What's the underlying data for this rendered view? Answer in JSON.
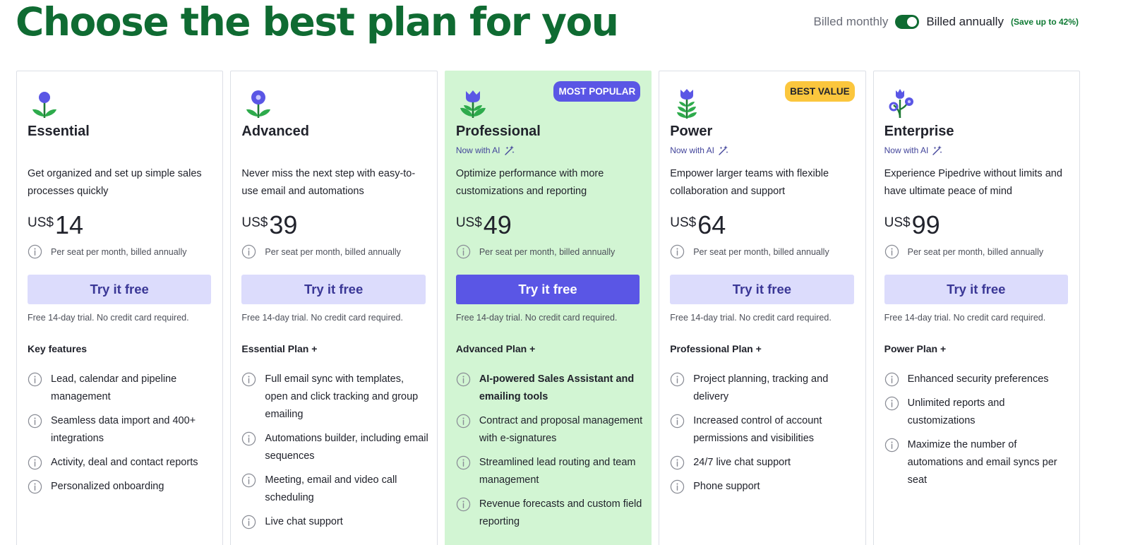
{
  "headline": "Choose the best plan for you",
  "billing": {
    "monthly_label": "Billed monthly",
    "annual_label": "Billed annually",
    "save_note": "(Save up to 42%)",
    "annual_selected": true
  },
  "colors": {
    "brand_green": "#0f6b32",
    "accent_purple": "#5a56e5",
    "button_light": "#dcdcfc",
    "highlight_bg": "#d2f5d3",
    "badge_yellow": "#fbc63d"
  },
  "plans": [
    {
      "icon": "flower-one-icon",
      "name": "Essential",
      "ai_label": "",
      "description": "Get organized and set up simple sales processes quickly",
      "currency": "US$",
      "price": "14",
      "per_seat": "Per seat per month, billed annually",
      "cta": "Try it free",
      "trial": "Free 14-day trial. No credit card required.",
      "features_heading": "Key features",
      "features": [
        "Lead, calendar and pipeline management",
        "Seamless data import and 400+ integrations",
        "Activity, deal and contact reports",
        "Personalized onboarding"
      ]
    },
    {
      "icon": "flower-two-icon",
      "name": "Advanced",
      "ai_label": "",
      "description": "Never miss the next step with easy-to-use email and automations",
      "currency": "US$",
      "price": "39",
      "per_seat": "Per seat per month, billed annually",
      "cta": "Try it free",
      "trial": "Free 14-day trial. No credit card required.",
      "features_heading": "Essential Plan +",
      "features": [
        "Full email sync with templates, open and click tracking and group emailing",
        "Automations builder, including email sequences",
        "Meeting, email and video call scheduling",
        "Live chat support"
      ]
    },
    {
      "icon": "tulip-icon",
      "badge": "MOST POPULAR",
      "name": "Professional",
      "ai_label": "Now with AI",
      "description": "Optimize performance with more customizations and reporting",
      "currency": "US$",
      "price": "49",
      "per_seat": "Per seat per month, billed annually",
      "cta": "Try it free",
      "trial": "Free 14-day trial. No credit card required.",
      "features_heading": "Advanced Plan +",
      "features": [
        "AI-powered Sales Assistant and emailing tools",
        "Contract and proposal management with e-signatures",
        "Streamlined lead routing and team management",
        "Revenue forecasts and custom field reporting"
      ]
    },
    {
      "icon": "tall-tulip-icon",
      "badge": "BEST VALUE",
      "name": "Power",
      "ai_label": "Now with AI",
      "description": "Empower larger teams with flexible collaboration and support",
      "currency": "US$",
      "price": "64",
      "per_seat": "Per seat per month, billed annually",
      "cta": "Try it free",
      "trial": "Free 14-day trial. No credit card required.",
      "features_heading": "Professional Plan +",
      "features": [
        "Project planning, tracking and delivery",
        "Increased control of account permissions and visibilities",
        "24/7 live chat support",
        "Phone support"
      ]
    },
    {
      "icon": "multi-flower-icon",
      "name": "Enterprise",
      "ai_label": "Now with AI",
      "description": "Experience Pipedrive without limits and have ultimate peace of mind",
      "currency": "US$",
      "price": "99",
      "per_seat": "Per seat per month, billed annually",
      "cta": "Try it free",
      "trial": "Free 14-day trial. No credit card required.",
      "features_heading": "Power Plan +",
      "features": [
        "Enhanced security preferences",
        "Unlimited reports and customizations",
        "Maximize the number of automations and email syncs per seat"
      ]
    }
  ]
}
